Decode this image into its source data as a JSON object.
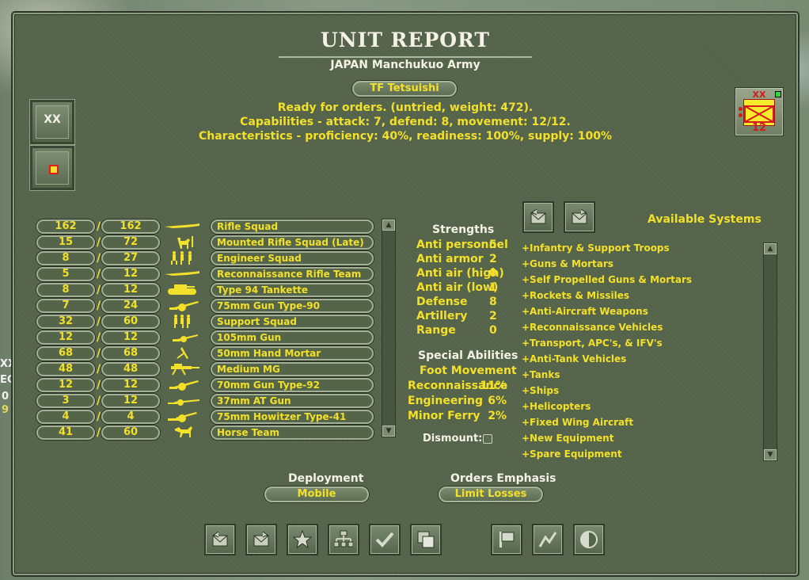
{
  "report": {
    "title": "UNIT REPORT",
    "subtitle": "JAPAN Manchukuo Army",
    "unit_name": "TF Tetsuishi",
    "status": "Ready for orders. (untried, weight: 472).",
    "capabilities": "Capabilities - attack: 7, defend: 8, movement: 12/12.",
    "characteristics": "Characteristics - proficiency: 40%, readiness: 100%, supply: 100%"
  },
  "side_buttons": {
    "formation_label": "XX"
  },
  "counter": {
    "top": "XX",
    "bottom": "12"
  },
  "map_fragments": [
    "XX",
    "EC",
    "0",
    "9"
  ],
  "equipment": [
    {
      "current": "162",
      "max": "162",
      "name": "Rifle Squad",
      "icon": "rifle-icon"
    },
    {
      "current": "15",
      "max": "72",
      "name": "Mounted Rifle Squad (Late)",
      "icon": "cavalry-icon"
    },
    {
      "current": "8",
      "max": "27",
      "name": "Engineer Squad",
      "icon": "engineer-icon"
    },
    {
      "current": "5",
      "max": "12",
      "name": "Reconnaissance Rifle Team",
      "icon": "rifle-icon"
    },
    {
      "current": "8",
      "max": "12",
      "name": "Type 94 Tankette",
      "icon": "tankette-icon"
    },
    {
      "current": "7",
      "max": "24",
      "name": "75mm Gun Type-90",
      "icon": "field-gun-icon"
    },
    {
      "current": "32",
      "max": "60",
      "name": "Support Squad",
      "icon": "support-squad-icon"
    },
    {
      "current": "12",
      "max": "12",
      "name": "105mm Gun",
      "icon": "gun-icon"
    },
    {
      "current": "68",
      "max": "68",
      "name": "50mm Hand Mortar",
      "icon": "mortar-icon"
    },
    {
      "current": "48",
      "max": "48",
      "name": "Medium MG",
      "icon": "machine-gun-icon"
    },
    {
      "current": "12",
      "max": "12",
      "name": "70mm Gun Type-92",
      "icon": "field-gun-icon"
    },
    {
      "current": "3",
      "max": "12",
      "name": "37mm AT Gun",
      "icon": "at-gun-icon"
    },
    {
      "current": "4",
      "max": "4",
      "name": "75mm Howitzer Type-41",
      "icon": "howitzer-icon"
    },
    {
      "current": "41",
      "max": "60",
      "name": "Horse Team",
      "icon": "horse-icon"
    }
  ],
  "strengths": {
    "header": "Strengths",
    "rows": [
      {
        "label": "Anti personnel",
        "value": "5"
      },
      {
        "label": "Anti armor",
        "value": "2"
      },
      {
        "label": "Anti air (high)",
        "value": "0"
      },
      {
        "label": "Anti air (low)",
        "value": "1"
      },
      {
        "label": "Defense",
        "value": "8"
      },
      {
        "label": "Artillery",
        "value": "2"
      },
      {
        "label": "Range",
        "value": "0"
      }
    ]
  },
  "abilities": {
    "header": "Special Abilities",
    "foot": "Foot Movement",
    "rows": [
      {
        "label": "Reconnaissance",
        "value": "11%"
      },
      {
        "label": "Engineering",
        "value": "6%"
      },
      {
        "label": "Minor Ferry",
        "value": "2%"
      }
    ],
    "dismount_label": "Dismount:"
  },
  "systems": {
    "header": "Available Systems",
    "items": [
      "+Infantry & Support Troops",
      "+Guns & Mortars",
      "+Self Propelled Guns & Mortars",
      "+Rockets & Missiles",
      "+Anti-Aircraft Weapons",
      "+Reconnaissance Vehicles",
      "+Transport, APC's, & IFV's",
      "+Anti-Tank Vehicles",
      "+Tanks",
      "+Ships",
      "+Helicopters",
      "+Fixed Wing Aircraft",
      "+New Equipment",
      "+Spare Equipment"
    ]
  },
  "deployment": {
    "label": "Deployment",
    "value": "Mobile"
  },
  "orders": {
    "label": "Orders Emphasis",
    "value": "Limit Losses"
  },
  "toolbar": [
    "prev-envelope-icon",
    "next-envelope-icon",
    "star-icon",
    "org-chart-icon",
    "checkmark-icon",
    "stack-icon",
    "flag-icon",
    "graph-icon",
    "half-circle-icon"
  ],
  "colors": {
    "panel": "#55654a",
    "text_yellow": "#f3e02a",
    "counter_red": "#e81e1e",
    "counter_yellow": "#f6ec2d"
  }
}
